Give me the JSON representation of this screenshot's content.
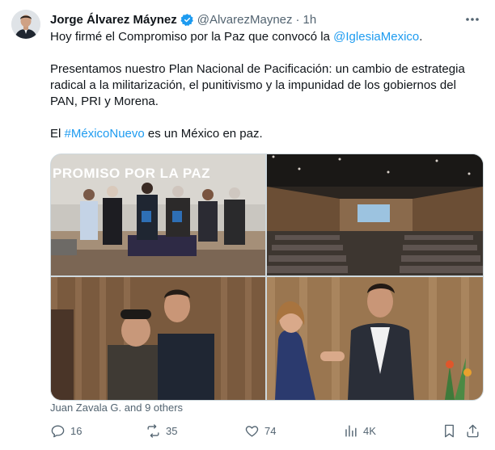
{
  "tweet": {
    "author_name": "Jorge Álvarez Máynez",
    "handle": "@AlvarezMaynez",
    "separator": "·",
    "time": "1h",
    "line1_before": "Hoy firmé el Compromiso por la Paz que convocó la ",
    "line1_mention": "@IglesiaMexico",
    "line1_after": ".",
    "para2": "Presentamos nuestro Plan Nacional de Pacificación: un cambio de estrategia radical a la militarización, el punitivismo y la impunidad de los gobiernos del PAN, PRI y Morena.",
    "para3_before": "El ",
    "para3_hashtag": "#MéxicoNuevo",
    "para3_after": " es un México en paz.",
    "banner_text": "PROMISO POR LA PAZ",
    "liked_by": "Juan Zavala G. and 9 others"
  },
  "actions": {
    "replies": "16",
    "reposts": "35",
    "likes": "74",
    "views": "4K"
  },
  "colors": {
    "link": "#1d9bf0",
    "muted": "#536471",
    "verified": "#1d9bf0"
  },
  "icons": [
    "more-icon",
    "verified-badge-icon",
    "reply-icon",
    "repost-icon",
    "like-icon",
    "views-icon",
    "bookmark-icon",
    "share-icon"
  ]
}
